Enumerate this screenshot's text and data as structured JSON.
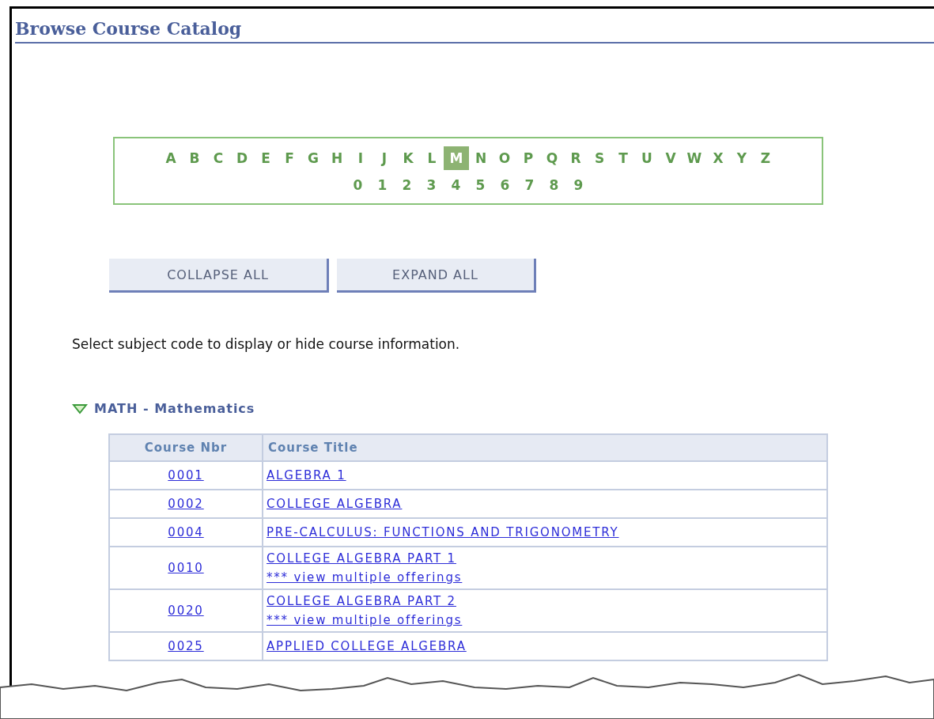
{
  "page": {
    "title": "Browse Course Catalog"
  },
  "letters": [
    {
      "label": "A",
      "selected": false
    },
    {
      "label": "B",
      "selected": false
    },
    {
      "label": "C",
      "selected": false
    },
    {
      "label": "D",
      "selected": false
    },
    {
      "label": "E",
      "selected": false
    },
    {
      "label": "F",
      "selected": false
    },
    {
      "label": "G",
      "selected": false
    },
    {
      "label": "H",
      "selected": false
    },
    {
      "label": "I",
      "selected": false
    },
    {
      "label": "J",
      "selected": false
    },
    {
      "label": "K",
      "selected": false
    },
    {
      "label": "L",
      "selected": false
    },
    {
      "label": "M",
      "selected": true
    },
    {
      "label": "N",
      "selected": false
    },
    {
      "label": "O",
      "selected": false
    },
    {
      "label": "P",
      "selected": false
    },
    {
      "label": "Q",
      "selected": false
    },
    {
      "label": "R",
      "selected": false
    },
    {
      "label": "S",
      "selected": false
    },
    {
      "label": "T",
      "selected": false
    },
    {
      "label": "U",
      "selected": false
    },
    {
      "label": "V",
      "selected": false
    },
    {
      "label": "W",
      "selected": false
    },
    {
      "label": "X",
      "selected": false
    },
    {
      "label": "Y",
      "selected": false
    },
    {
      "label": "Z",
      "selected": false
    }
  ],
  "digits": [
    {
      "label": "0",
      "selected": false
    },
    {
      "label": "1",
      "selected": false
    },
    {
      "label": "2",
      "selected": false
    },
    {
      "label": "3",
      "selected": false
    },
    {
      "label": "4",
      "selected": false
    },
    {
      "label": "5",
      "selected": false
    },
    {
      "label": "6",
      "selected": false
    },
    {
      "label": "7",
      "selected": false
    },
    {
      "label": "8",
      "selected": false
    },
    {
      "label": "9",
      "selected": false
    }
  ],
  "buttons": [
    "COLLAPSE ALL",
    "EXPAND ALL"
  ],
  "instruction": "Select subject code to display or hide course information.",
  "subject": {
    "label": "MATH - Mathematics",
    "expanded": true
  },
  "table": {
    "columns": [
      "Course Nbr",
      "Course Title"
    ],
    "rows": [
      {
        "number": "0001",
        "title": "ALGEBRA 1"
      },
      {
        "number": "0002",
        "title": "COLLEGE ALGEBRA"
      },
      {
        "number": "0004",
        "title": "PRE-CALCULUS: FUNCTIONS AND TRIGONOMETRY"
      },
      {
        "number": "0010",
        "title": "COLLEGE ALGEBRA PART 1",
        "offerings": "*** view multiple offerings"
      },
      {
        "number": "0020",
        "title": "COLLEGE ALGEBRA PART 2",
        "offerings": "*** view multiple offerings"
      },
      {
        "number": "0025",
        "title": "APPLIED COLLEGE ALGEBRA"
      }
    ]
  }
}
